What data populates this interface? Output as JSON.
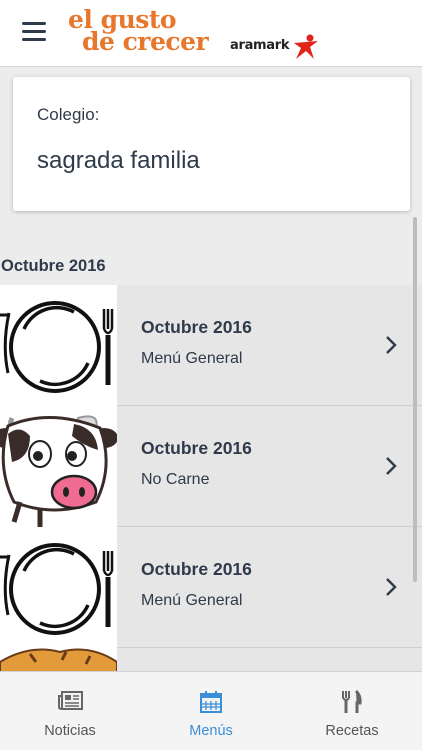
{
  "header": {
    "logo_line1": "el gusto",
    "logo_line2": "de crecer",
    "brand": "aramark",
    "menu_icon": "hamburger-icon"
  },
  "school": {
    "label": "Colegio:",
    "name": "sagrada familia"
  },
  "section": {
    "title": "Octubre 2016"
  },
  "menus": [
    {
      "title": "Octubre 2016",
      "subtitle": "Menú General",
      "image": "plate-cutlery"
    },
    {
      "title": "Octubre 2016",
      "subtitle": "No Carne",
      "image": "cow"
    },
    {
      "title": "Octubre 2016",
      "subtitle": "Menú General",
      "image": "plate-cutlery"
    },
    {
      "title": "",
      "subtitle": "",
      "image": "cow-orange"
    }
  ],
  "tabs": [
    {
      "label": "Noticias",
      "icon": "newspaper-icon",
      "active": false
    },
    {
      "label": "Menús",
      "icon": "calendar-icon",
      "active": true
    },
    {
      "label": "Recetas",
      "icon": "cutlery-icon",
      "active": false
    }
  ],
  "colors": {
    "logo_orange": "#e8772e",
    "text_dark": "#2f3a4a",
    "accent_blue": "#3b8fd9",
    "brand_red": "#e2231a"
  }
}
